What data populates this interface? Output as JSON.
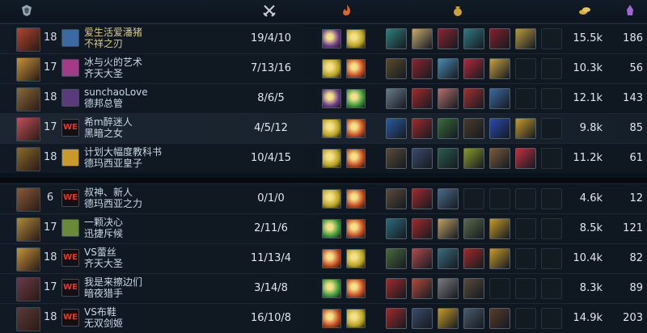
{
  "header": {
    "icons": [
      "team-crest-icon",
      "crossed-swords-icon",
      "flame-icon",
      "gold-bag-icon",
      "gold-coins-icon",
      "minion-icon"
    ]
  },
  "players": [
    {
      "level": "18",
      "badge": "",
      "name": "爱生活爱潘猪",
      "champion": "不祥之刃",
      "kda": "19/4/10",
      "gold": "15.5k",
      "cs": "186",
      "avatar_color": "#b3452f",
      "badge_color": "#3a6aa0",
      "spells": [
        "#6a3a8a",
        "#b8a21f"
      ],
      "items": [
        "#2d7f7a",
        "#c7a96d",
        "#8b2530",
        "#2f7a80",
        "#84202b",
        "#b79a40",
        ""
      ],
      "highlight": true
    },
    {
      "level": "17",
      "badge": "",
      "name": "冰与火的艺术",
      "champion": "齐天大圣",
      "kda": "7/13/16",
      "gold": "10.3k",
      "cs": "56",
      "avatar_color": "#c7933a",
      "badge_color": "#a33a8a",
      "spells": [
        "#b8a21f",
        "#c74a1f"
      ],
      "items": [
        "#5a4a2a",
        "#8b2530",
        "#4a8ab0",
        "#b02a3a",
        "#c7a040",
        "",
        ""
      ]
    },
    {
      "level": "18",
      "badge": "",
      "name": "sunchaoLove",
      "champion": "德邦总管",
      "kda": "8/6/5",
      "gold": "12.1k",
      "cs": "143",
      "avatar_color": "#8a6a3a",
      "badge_color": "#5a3a7a",
      "spells": [
        "#6a3a8a",
        "#3a9a3a"
      ],
      "items": [
        "#6a7a8a",
        "#a02a2a",
        "#b0706a",
        "#a03030",
        "#3a6aa0",
        "",
        ""
      ]
    },
    {
      "level": "17",
      "badge": "WE",
      "name": "希m醉迷人",
      "champion": "黑暗之女",
      "kda": "4/5/12",
      "gold": "9.8k",
      "cs": "85",
      "avatar_color": "#c0505a",
      "badge_color": "",
      "spells": [
        "#b8a21f",
        "#c74a1f"
      ],
      "items": [
        "#2a5aa0",
        "#a02a2a",
        "#3a6a3a",
        "#4a3a2a",
        "#2a4ab0",
        "#c79a2a",
        ""
      ],
      "selected": true
    },
    {
      "level": "18",
      "badge": "",
      "name": "计划大幅度教科书",
      "champion": "德玛西亚皇子",
      "kda": "10/4/15",
      "gold": "11.2k",
      "cs": "61",
      "avatar_color": "#8a6a2a",
      "badge_color": "#c79a2a",
      "spells": [
        "#b8a21f",
        "#c74a1f"
      ],
      "items": [
        "#5a4a3a",
        "#3a4a6a",
        "#2a5a4a",
        "#8a9a2a",
        "#7a5a3a",
        "#c03040",
        ""
      ]
    },
    {
      "level": "6",
      "badge": "WE",
      "name": "叔神、新人",
      "champion": "德玛西亚之力",
      "kda": "0/1/0",
      "gold": "4.6k",
      "cs": "12",
      "avatar_color": "#8a5a3a",
      "badge_color": "",
      "spells": [
        "#b8a21f",
        "#c74a1f"
      ],
      "items": [
        "#5a4a3a",
        "#a02a2a",
        "#4a6a8a",
        "",
        "",
        "",
        ""
      ]
    },
    {
      "level": "17",
      "badge": "",
      "name": "一颗决心",
      "champion": "迅捷斥候",
      "kda": "2/11/6",
      "gold": "8.5k",
      "cs": "121",
      "avatar_color": "#b08a3a",
      "badge_color": "#6a8a3a",
      "spells": [
        "#3a9a3a",
        "#c74a1f"
      ],
      "items": [
        "#2a6a7a",
        "#a02a2a",
        "#c0a060",
        "#5a6a4a",
        "#c79a2a",
        "",
        ""
      ]
    },
    {
      "level": "18",
      "badge": "WE",
      "name": "VS蕾丝",
      "champion": "齐天大圣",
      "kda": "11/13/4",
      "gold": "10.4k",
      "cs": "82",
      "avatar_color": "#c7933a",
      "badge_color": "",
      "spells": [
        "#c74a1f",
        "#b8a21f"
      ],
      "items": [
        "#4a6a3a",
        "#b04a4a",
        "#3a6a7a",
        "#a02a2a",
        "#c79a2a",
        "",
        ""
      ]
    },
    {
      "level": "17",
      "badge": "WE",
      "name": "我是来擦边们",
      "champion": "暗夜猎手",
      "kda": "3/14/8",
      "gold": "8.3k",
      "cs": "89",
      "avatar_color": "#6a3a4a",
      "badge_color": "",
      "spells": [
        "#3a9a3a",
        "#c74a1f"
      ],
      "items": [
        "#a02a2a",
        "#b04a3a",
        "#7a7a7a",
        "#5a4a3a",
        "",
        "",
        ""
      ]
    },
    {
      "level": "18",
      "badge": "WE",
      "name": "VS布鞋",
      "champion": "无双剑姬",
      "kda": "16/10/8",
      "gold": "14.9k",
      "cs": "203",
      "avatar_color": "#5a3a3a",
      "badge_color": "",
      "spells": [
        "#c74a1f",
        "#b8a21f"
      ],
      "items": [
        "#a02a2a",
        "#3a4a6a",
        "#c79a2a",
        "#4a5a6a",
        "#5a3a2a",
        "",
        ""
      ]
    }
  ]
}
